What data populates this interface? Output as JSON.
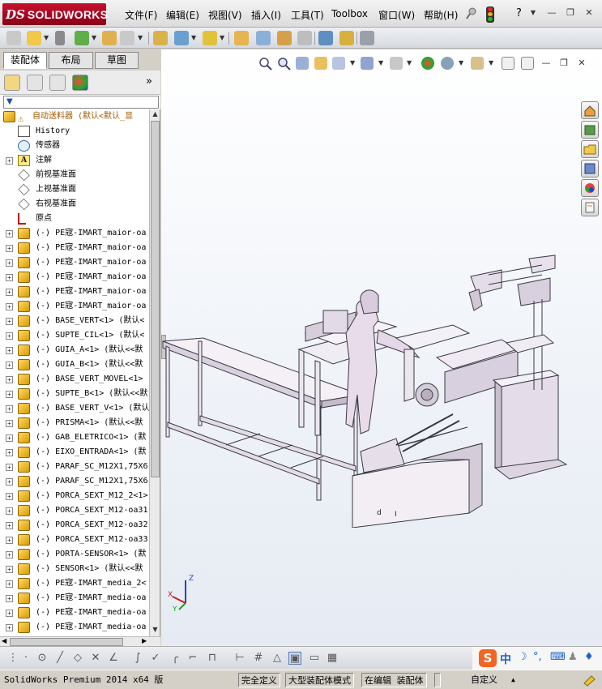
{
  "app": {
    "brand_ds": "DS",
    "brand_name": "SOLIDWORKS"
  },
  "menu": {
    "items": [
      "文件(F)",
      "编辑(E)",
      "视图(V)",
      "插入(I)",
      "工具(T)",
      "Toolbox",
      "窗口(W)",
      "帮助(H)"
    ],
    "help_label": "?"
  },
  "left_panel": {
    "tabs": [
      "装配体",
      "布局",
      "草图"
    ],
    "active_tab": 0,
    "filter_symbol": "▼",
    "tree": [
      {
        "label": "自动送料器  (默认<默认_显",
        "icon": "assembly",
        "root": true,
        "expandable": false
      },
      {
        "label": "History",
        "icon": "history",
        "expandable": false
      },
      {
        "label": "传感器",
        "icon": "sensor",
        "expandable": false
      },
      {
        "label": "注解",
        "icon": "annotation",
        "expandable": true
      },
      {
        "label": "前视基准面",
        "icon": "plane",
        "expandable": false
      },
      {
        "label": "上视基准面",
        "icon": "plane",
        "expandable": false
      },
      {
        "label": "右视基准面",
        "icon": "plane",
        "expandable": false
      },
      {
        "label": "原点",
        "icon": "origin",
        "expandable": false
      },
      {
        "label": "(-) PE宼-IMART_maior-oa",
        "icon": "part",
        "expandable": true
      },
      {
        "label": "(-) PE宼-IMART_maior-oa",
        "icon": "part",
        "expandable": true
      },
      {
        "label": "(-) PE宼-IMART_maior-oa",
        "icon": "part",
        "expandable": true
      },
      {
        "label": "(-) PE宼-IMART_maior-oa",
        "icon": "part",
        "expandable": true
      },
      {
        "label": "(-) PE宼-IMART_maior-oa",
        "icon": "part",
        "expandable": true
      },
      {
        "label": "(-) PE宼-IMART_maior-oa",
        "icon": "part",
        "expandable": true
      },
      {
        "label": "(-) BASE_VERT<1> (默认<",
        "icon": "part",
        "expandable": true
      },
      {
        "label": "(-) SUPTE_CIL<1> (默认<",
        "icon": "part",
        "expandable": true
      },
      {
        "label": "(-) GUIA_A<1> (默认<<默",
        "icon": "part",
        "expandable": true
      },
      {
        "label": "(-) GUIA_B<1> (默认<<默",
        "icon": "part",
        "expandable": true
      },
      {
        "label": "(-) BASE_VERT_MOVEL<1>",
        "icon": "part",
        "expandable": true
      },
      {
        "label": "(-) SUPTE_B<1> (默认<<默",
        "icon": "part",
        "expandable": true
      },
      {
        "label": "(-) BASE_VERT_V<1> (默认",
        "icon": "part",
        "expandable": true
      },
      {
        "label": "(-) PRISMA<1> (默认<<默",
        "icon": "part",
        "expandable": true
      },
      {
        "label": "(-) GAB_ELETRICO<1> (默",
        "icon": "part",
        "expandable": true
      },
      {
        "label": "(-) EIXO_ENTRADA<1> (默",
        "icon": "part",
        "expandable": true
      },
      {
        "label": "(-) PARAF_SC_M12X1,75X6",
        "icon": "part",
        "expandable": true
      },
      {
        "label": "(-) PARAF_SC_M12X1,75X6",
        "icon": "part",
        "expandable": true
      },
      {
        "label": "(-) PORCA_SEXT_M12_2<1>",
        "icon": "part",
        "expandable": true
      },
      {
        "label": "(-) PORCA_SEXT_M12-oa31",
        "icon": "part",
        "expandable": true
      },
      {
        "label": "(-) PORCA_SEXT_M12-oa32",
        "icon": "part",
        "expandable": true
      },
      {
        "label": "(-) PORCA_SEXT_M12-oa33",
        "icon": "part",
        "expandable": true
      },
      {
        "label": "(-) PORTA-SENSOR<1> (默",
        "icon": "part",
        "expandable": true
      },
      {
        "label": "(-) SENSOR<1> (默认<<默",
        "icon": "part",
        "expandable": true
      },
      {
        "label": "(-) PE宼-IMART_media_2<",
        "icon": "part",
        "expandable": true
      },
      {
        "label": "(-) PE宼-IMART_media-oa",
        "icon": "part",
        "expandable": true
      },
      {
        "label": "(-) PE宼-IMART_media-oa",
        "icon": "part",
        "expandable": true
      },
      {
        "label": "(-) PE宼-IMART_media-oa",
        "icon": "part",
        "expandable": true
      }
    ]
  },
  "viewport": {
    "triad": {
      "x_label": "X",
      "y_label": "Y",
      "z_label": "Z"
    },
    "model_marks": [
      "d",
      "I"
    ]
  },
  "status_bar": {
    "product": "SolidWorks Premium 2014 x64 版",
    "definition": "完全定义",
    "mode": "大型装配体模式",
    "editing": "在编辑 装配体",
    "units": "自定义",
    "caret": "▲"
  },
  "colors": {
    "brand_red": "#c8102e",
    "part_icon": "#e0a800",
    "model_fill": "#ece6ee",
    "model_stroke": "#3a3a44"
  },
  "ime": {
    "logo": "S",
    "lang": "中"
  }
}
